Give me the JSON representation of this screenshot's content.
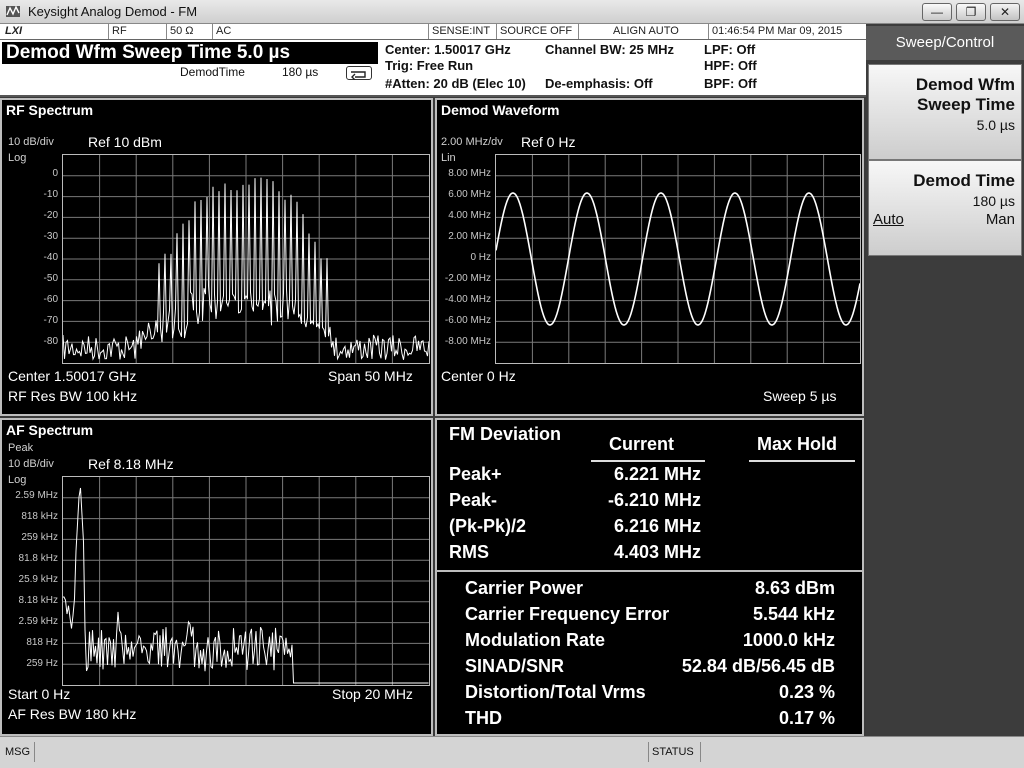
{
  "window": {
    "title": "Keysight Analog Demod - FM",
    "minimize": "—",
    "restore": "❐",
    "close": "✕"
  },
  "status_strip": {
    "logo": "LXI",
    "input": "RF",
    "impedance": "50 Ω",
    "coupling": "AC",
    "sense": "SENSE:INT",
    "source": "SOURCE OFF",
    "align": "ALIGN AUTO",
    "datetime": "01:46:54 PM Mar 09, 2015"
  },
  "header": {
    "title": "Demod Wfm Sweep Time 5.0 µs",
    "demod_time_label": "DemodTime",
    "demod_time_value": "180 µs",
    "center": "Center: 1.50017 GHz",
    "trig": "Trig: Free Run",
    "atten": "#Atten: 20 dB (Elec 10)",
    "channel_bw": "Channel BW: 25 MHz",
    "deemphasis": "De-emphasis: Off",
    "lpf": "LPF: Off",
    "hpf": "HPF: Off",
    "bpf": "BPF: Off"
  },
  "rf_spectrum": {
    "title": "RF Spectrum",
    "scale": "10 dB/div",
    "ref": "Ref  10 dBm",
    "mode": "Log",
    "y_ticks": [
      "0",
      "-10",
      "-20",
      "-30",
      "-40",
      "-50",
      "-60",
      "-70",
      "-80"
    ],
    "center": "Center  1.50017 GHz",
    "span": "Span 50 MHz",
    "res_bw": "RF Res BW   100 kHz"
  },
  "demod_waveform": {
    "title": "Demod Waveform",
    "scale": "2.00 MHz/dv",
    "ref": "Ref 0 Hz",
    "mode": "Lin",
    "y_ticks": [
      "8.00 MHz",
      "6.00 MHz",
      "4.00 MHz",
      "2.00 MHz",
      "0 Hz",
      "-2.00 MHz",
      "-4.00 MHz",
      "-6.00 MHz",
      "-8.00 MHz"
    ],
    "center": "Center  0 Hz",
    "sweep": "Sweep   5 µs"
  },
  "af_spectrum": {
    "title": "AF Spectrum",
    "detector": "Peak",
    "scale": "10 dB/div",
    "ref": "Ref 8.18 MHz",
    "mode": "Log",
    "y_ticks": [
      "2.59 MHz",
      "818 kHz",
      "259 kHz",
      "81.8 kHz",
      "25.9 kHz",
      "8.18 kHz",
      "2.59 kHz",
      "818 Hz",
      "259 Hz"
    ],
    "start": "Start  0 Hz",
    "stop": "Stop 20 MHz",
    "res_bw": "AF Res BW   180 kHz"
  },
  "fm_deviation": {
    "title": "FM Deviation",
    "col_current": "Current",
    "col_max_hold": "Max Hold",
    "rows": [
      {
        "label": "Peak+",
        "current": "6.221 MHz"
      },
      {
        "label": "Peak-",
        "current": "-6.210 MHz"
      },
      {
        "label": "(Pk-Pk)/2",
        "current": "6.216 MHz"
      },
      {
        "label": "RMS",
        "current": "4.403 MHz"
      }
    ]
  },
  "metrics": [
    {
      "label": "Carrier Power",
      "value": "8.63 dBm"
    },
    {
      "label": "Carrier Frequency Error",
      "value": "5.544 kHz"
    },
    {
      "label": "Modulation Rate",
      "value": "1000.0 kHz"
    },
    {
      "label": "SINAD/SNR",
      "value": "52.84 dB/56.45 dB"
    },
    {
      "label": "Distortion/Total Vrms",
      "value": "0.23 %"
    },
    {
      "label": "THD",
      "value": "0.17 %"
    }
  ],
  "softkeys": {
    "menu_title": "Sweep/Control",
    "sweep_time_line1": "Demod Wfm",
    "sweep_time_line2": "Sweep Time",
    "sweep_time_value": "5.0 µs",
    "demod_time_label": "Demod Time",
    "demod_time_value": "180 µs",
    "auto": "Auto",
    "man": "Man"
  },
  "bottom": {
    "msg": "MSG",
    "status": "STATUS"
  }
}
